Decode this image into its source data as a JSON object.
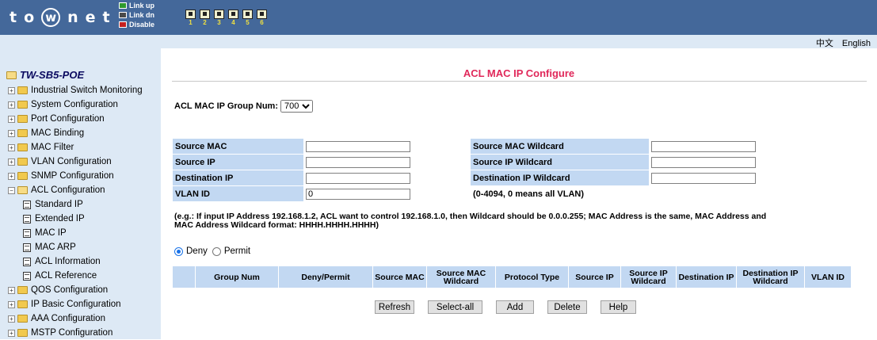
{
  "header": {
    "logo_before": "to",
    "logo_circle": "w",
    "logo_after": "net",
    "legend": [
      {
        "label": "Link up",
        "status": "up",
        "color": "#2e9a2e"
      },
      {
        "label": "Link dn",
        "status": "dn",
        "color": "#4a4a4a"
      },
      {
        "label": "Disable",
        "status": "disable",
        "color": "#c42020"
      }
    ],
    "ports": [
      "1",
      "2",
      "3",
      "4",
      "5",
      "6"
    ]
  },
  "lang": {
    "chinese": "中文",
    "english": "English"
  },
  "sidebar": {
    "root": "TW-SB5-POE",
    "items": [
      {
        "label": "Industrial Switch Monitoring"
      },
      {
        "label": "System Configuration"
      },
      {
        "label": "Port Configuration"
      },
      {
        "label": "MAC Binding"
      },
      {
        "label": "MAC Filter"
      },
      {
        "label": "VLAN Configuration"
      },
      {
        "label": "SNMP Configuration"
      },
      {
        "label": "ACL Configuration"
      },
      {
        "label": "QOS Configuration"
      },
      {
        "label": "IP Basic Configuration"
      },
      {
        "label": "AAA Configuration"
      },
      {
        "label": "MSTP Configuration"
      }
    ],
    "acl_children": [
      {
        "label": "Standard IP"
      },
      {
        "label": "Extended IP"
      },
      {
        "label": "MAC IP"
      },
      {
        "label": "MAC ARP"
      },
      {
        "label": "ACL Information"
      },
      {
        "label": "ACL Reference"
      }
    ]
  },
  "main": {
    "title": "ACL MAC IP Configure",
    "group_label": "ACL MAC IP Group Num:",
    "group_value": "700",
    "form": {
      "source_mac": "Source MAC",
      "source_mac_wildcard": "Source MAC Wildcard",
      "source_ip": "Source IP",
      "source_ip_wildcard": "Source IP Wildcard",
      "destination_ip": "Destination IP",
      "destination_ip_wildcard": "Destination IP Wildcard",
      "vlan_id": "VLAN ID",
      "vlan_value": "0",
      "vlan_hint": "(0-4094, 0 means all VLAN)"
    },
    "example_note": "(e.g.: If input IP Address 192.168.1.2, ACL want to control 192.168.1.0, then Wildcard should be 0.0.0.255; MAC Address is the same, MAC Address and MAC Address Wildcard format: HHHH.HHHH.HHHH)",
    "radio": {
      "deny": "Deny",
      "permit": "Permit",
      "selected": "deny"
    },
    "table_headers": [
      "",
      "Group Num",
      "Deny/Permit",
      "Source MAC",
      "Source MAC Wildcard",
      "Protocol Type",
      "Source IP",
      "Source IP Wildcard",
      "Destination IP",
      "Destination IP Wildcard",
      "VLAN ID"
    ],
    "buttons": {
      "refresh": "Refresh",
      "select_all": "Select-all",
      "add": "Add",
      "delete": "Delete",
      "help": "Help"
    }
  }
}
